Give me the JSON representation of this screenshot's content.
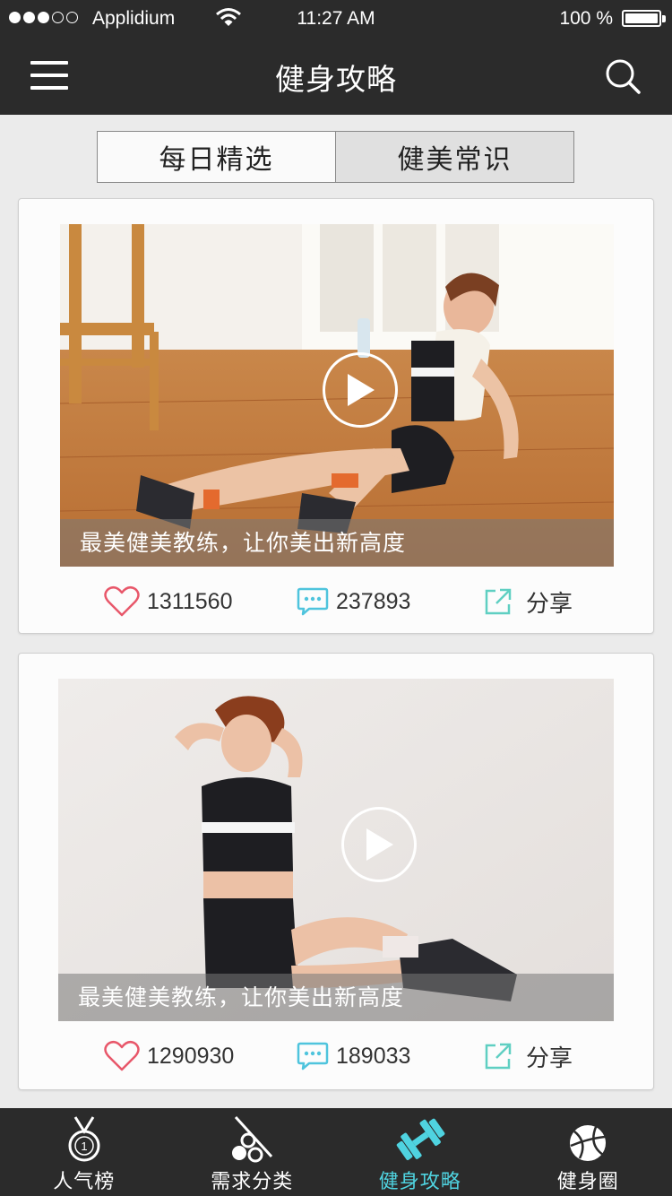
{
  "status_bar": {
    "carrier": "Applidium",
    "time": "11:27 AM",
    "battery": "100 %",
    "signal_bars_filled": 3,
    "signal_bars_total": 5
  },
  "nav": {
    "title": "健身攻略",
    "menu_icon": "hamburger-menu-icon",
    "search_icon": "search-icon"
  },
  "segments": [
    {
      "label": "每日精选",
      "selected": true
    },
    {
      "label": "健美常识",
      "selected": false
    }
  ],
  "posts": [
    {
      "caption": "最美健美教练，让你美出新高度",
      "likes": "1311560",
      "comments": "237893",
      "share_label": "分享"
    },
    {
      "caption": "最美健美教练，让你美出新高度",
      "likes": "1290930",
      "comments": "189033",
      "share_label": "分享"
    }
  ],
  "tabbar": [
    {
      "label": "人气榜",
      "icon": "medal-icon",
      "active": false
    },
    {
      "label": "需求分类",
      "icon": "sports-equipment-icon",
      "active": false
    },
    {
      "label": "健身攻略",
      "icon": "dumbbell-icon",
      "active": true
    },
    {
      "label": "健身圈",
      "icon": "basketball-icon",
      "active": false
    }
  ],
  "colors": {
    "bar_bg": "#2b2b2b",
    "page_bg": "#ebebeb",
    "like": "#e8576a",
    "comment": "#4fc4dd",
    "share": "#5fcfc2",
    "active_tab": "#4fd3e0"
  }
}
